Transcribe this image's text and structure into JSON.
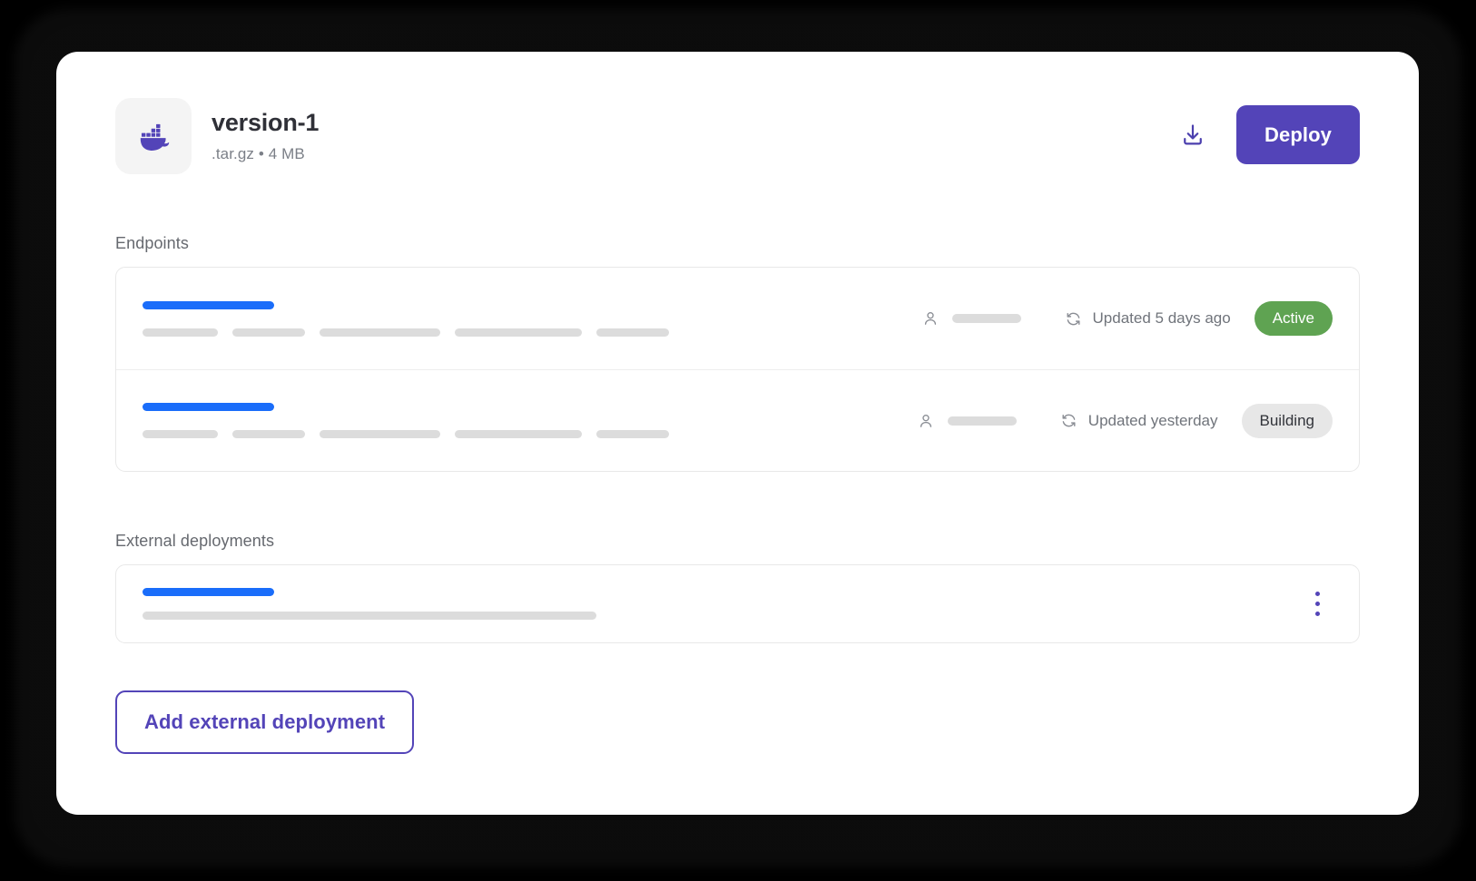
{
  "file": {
    "icon": "docker-whale-icon",
    "title": "version-1",
    "subtitle": ".tar.gz • 4 MB"
  },
  "header_actions": {
    "download_icon": "download-icon",
    "deploy_label": "Deploy"
  },
  "sections": {
    "endpoints_label": "Endpoints",
    "external_label": "External deployments"
  },
  "endpoints": [
    {
      "title_bar_width": 145,
      "skeleton_widths": [
        83,
        80,
        133,
        140,
        80
      ],
      "owner_icon": "user-icon",
      "updated_icon": "sync-icon",
      "updated": "Updated 5 days ago",
      "status": "Active",
      "status_kind": "active"
    },
    {
      "title_bar_width": 145,
      "skeleton_widths": [
        83,
        80,
        133,
        140,
        80
      ],
      "owner_icon": "user-icon",
      "updated_icon": "sync-icon",
      "updated": "Updated yesterday",
      "status": "Building",
      "status_kind": "building"
    }
  ],
  "external_deployments": [
    {
      "title_bar_width": 145,
      "detail_bar_width": 500,
      "menu_icon": "kebab-menu-icon"
    }
  ],
  "footer": {
    "add_label": "Add external deployment"
  },
  "colors": {
    "brand_purple": "#5344b8",
    "link_blue": "#1a6dfa",
    "status_active": "#5fa352",
    "status_building": "#e7e7e7",
    "skeleton_gray": "#dcdcdc"
  }
}
